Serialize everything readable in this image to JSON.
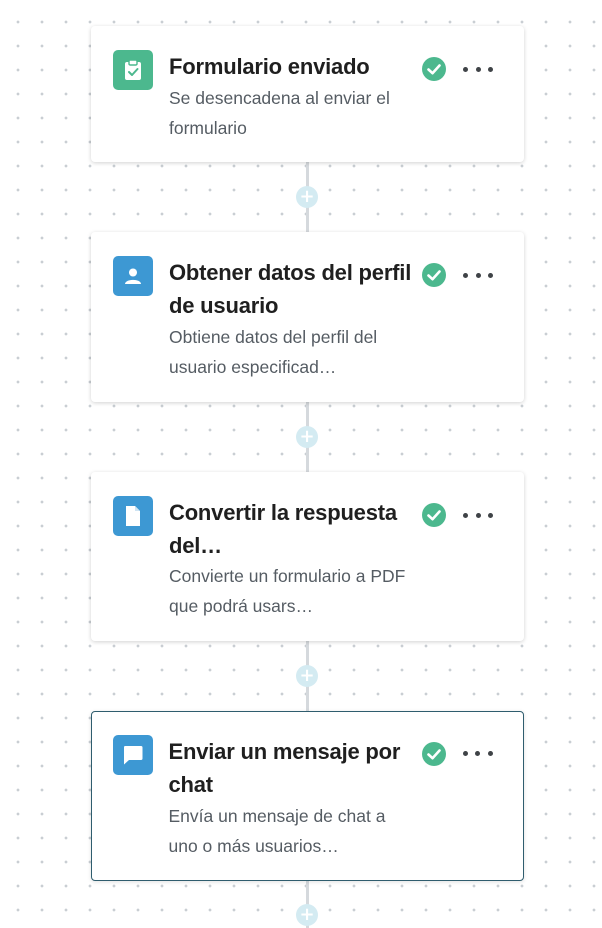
{
  "colors": {
    "trigger_icon_bg": "#4cb88e",
    "action_icon_bg": "#3d98d3",
    "status_check": "#4cb88e",
    "selected_border": "#2f5d6e",
    "connector": "#d5d9dd",
    "add_button": "#d4ebf2"
  },
  "steps": [
    {
      "icon": "form-submitted-icon",
      "title": "Formulario enviado",
      "description": "Se desencadena al enviar el formulario",
      "status": "check-circle-icon",
      "selected": false
    },
    {
      "icon": "user-profile-icon",
      "title": "Obtener datos del perfil de usuario",
      "description": "Obtiene datos del perfil del usuario especificad…",
      "status": "check-circle-icon",
      "selected": false
    },
    {
      "icon": "document-icon",
      "title": "Convertir la respuesta del…",
      "description": "Convierte un formulario a PDF que podrá usars…",
      "status": "check-circle-icon",
      "selected": false
    },
    {
      "icon": "chat-message-icon",
      "title": "Enviar un mensaje por chat",
      "description": "Envía un mensaje de chat a uno o más usuarios…",
      "status": "check-circle-icon",
      "selected": true
    }
  ],
  "add_step_symbol": "+"
}
